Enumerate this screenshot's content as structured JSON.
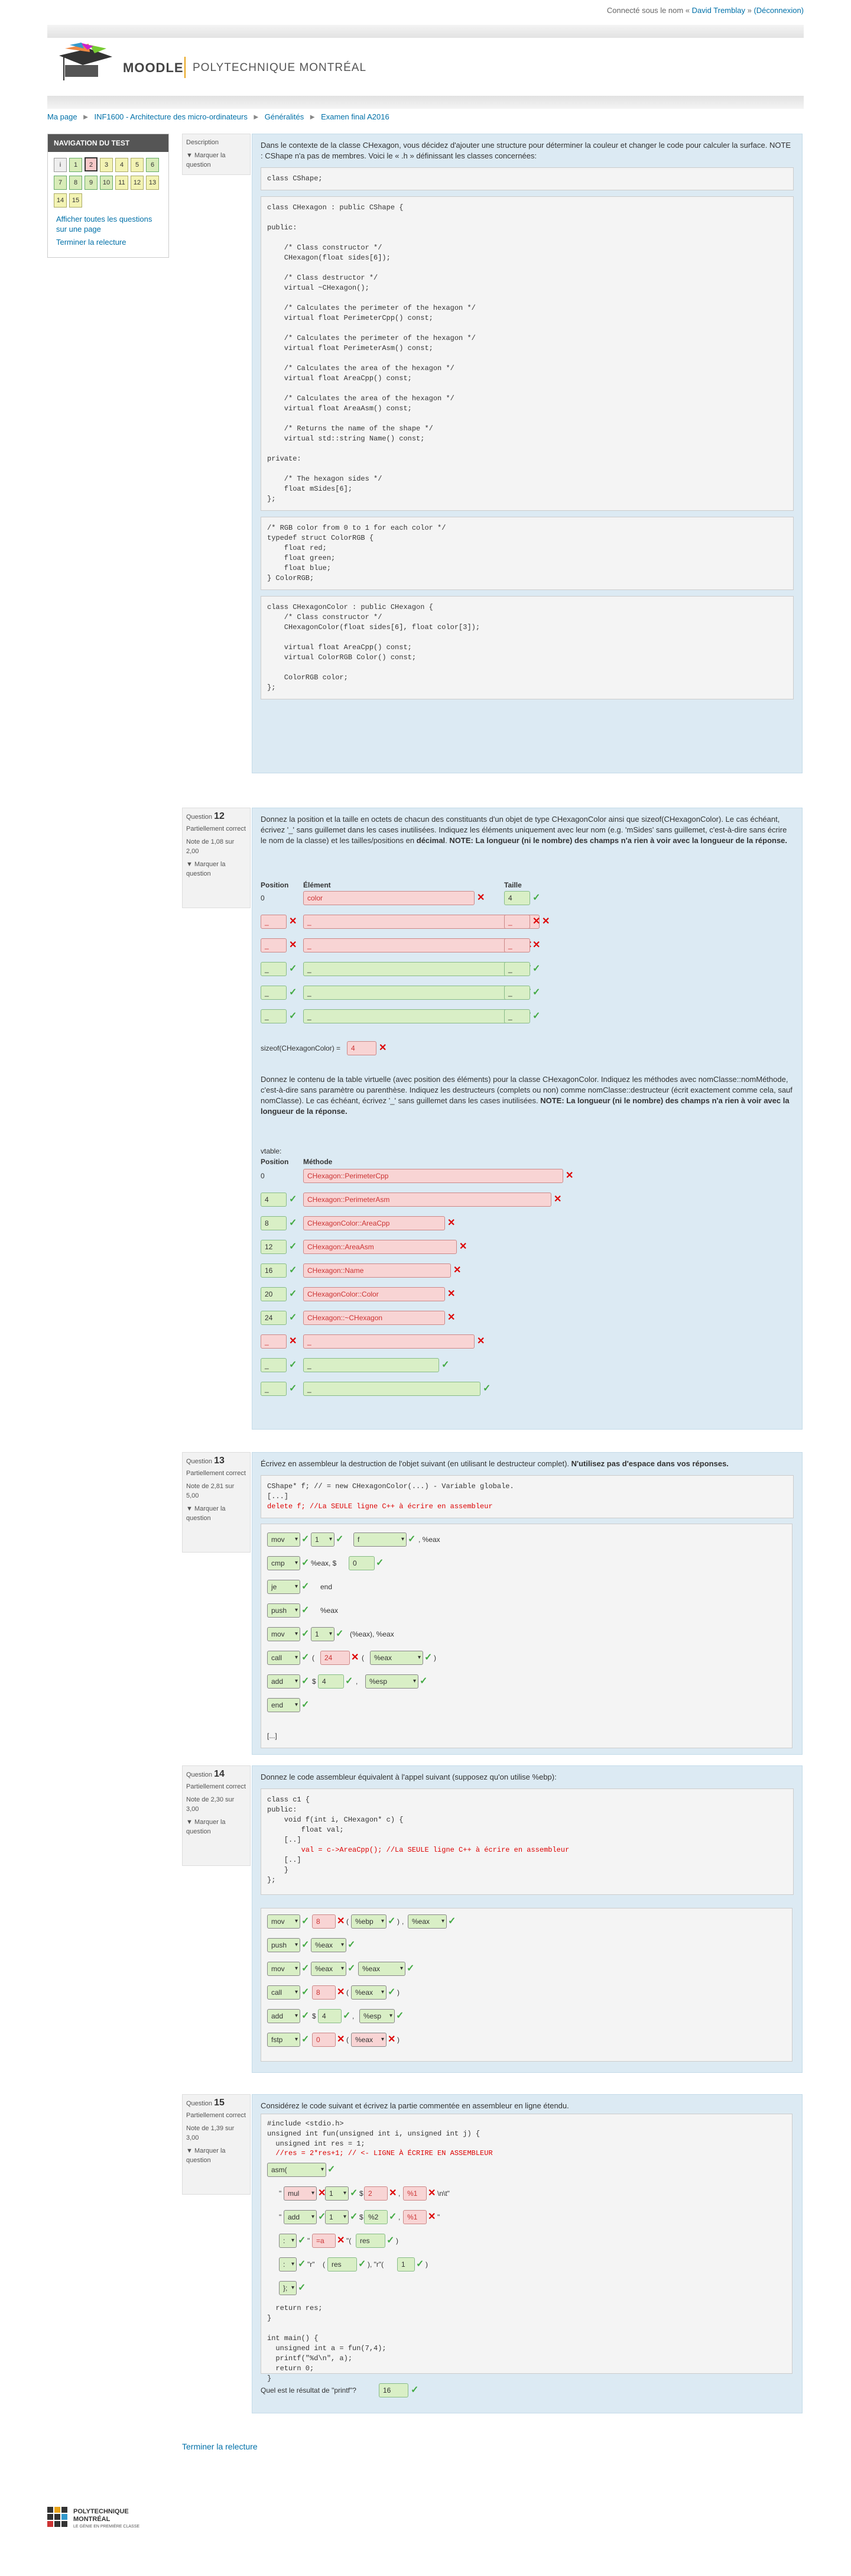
{
  "login": {
    "prefix": "Connecté sous le nom « ",
    "user": "David Tremblay",
    "suffix": " » ",
    "logout": "(Déconnexion)"
  },
  "header": {
    "moodle": "MOODLE",
    "school": "POLYTECHNIQUE MONTRÉAL"
  },
  "breadcrumb": [
    "Ma page",
    "INF1600 - Architecture des micro-ordinateurs",
    "Généralités",
    "Examen final A2016"
  ],
  "nav": {
    "title": "NAVIGATION DU TEST",
    "buttons": [
      {
        "n": "i",
        "s": "info"
      },
      {
        "n": "1",
        "s": "ok"
      },
      {
        "n": "2",
        "s": "bad"
      },
      {
        "n": "3",
        "s": "part"
      },
      {
        "n": "4",
        "s": "part"
      },
      {
        "n": "5",
        "s": "part"
      },
      {
        "n": "6",
        "s": "ok"
      },
      {
        "n": "7",
        "s": "ok"
      },
      {
        "n": "8",
        "s": "ok"
      },
      {
        "n": "9",
        "s": "ok"
      },
      {
        "n": "10",
        "s": "ok"
      },
      {
        "n": "11",
        "s": "part"
      },
      {
        "n": "12",
        "s": "part"
      },
      {
        "n": "13",
        "s": "part"
      },
      {
        "n": "14",
        "s": "part"
      },
      {
        "n": "15",
        "s": "part"
      }
    ],
    "show_all": "Afficher toutes les questions sur une page",
    "finish": "Terminer la relecture"
  },
  "desc": {
    "label": "Description",
    "flag": "Marquer la question",
    "intro": "Dans le contexte de la classe CHexagon, vous décidez d'ajouter une structure pour déterminer la couleur et changer le code pour calculer la surface.  NOTE : CShape n'a pas de membres. Voici le « .h » définissant les classes concernées:",
    "code1": "class CShape;",
    "code2": "class CHexagon : public CShape {\n\npublic:\n\n    /* Class constructor */\n    CHexagon(float sides[6]);\n\n    /* Class destructor */\n    virtual ~CHexagon();\n\n    /* Calculates the perimeter of the hexagon */\n    virtual float PerimeterCpp() const;\n\n    /* Calculates the perimeter of the hexagon */\n    virtual float PerimeterAsm() const;\n\n    /* Calculates the area of the hexagon */\n    virtual float AreaCpp() const;\n\n    /* Calculates the area of the hexagon */\n    virtual float AreaAsm() const;\n\n    /* Returns the name of the shape */\n    virtual std::string Name() const;\n\nprivate:\n\n    /* The hexagon sides */\n    float mSides[6];\n};",
    "code3": "/* RGB color from 0 to 1 for each color */\ntypedef struct ColorRGB {\n    float red;\n    float green;\n    float blue;\n} ColorRGB;",
    "code4": "class CHexagonColor : public CHexagon {\n    /* Class constructor */\n    CHexagonColor(float sides[6], float color[3]);\n\n    virtual float AreaCpp() const;\n    virtual ColorRGB Color() const;\n\n    ColorRGB color;\n};"
  },
  "q12": {
    "label": "Question",
    "num": "12",
    "state": "Partiellement correct",
    "grade": "Note de 1,08 sur 2,00",
    "flag": "Marquer la question",
    "text": "Donnez la position et la taille en octets de chacun des constituants d'un objet de type CHexagonColor ainsi que sizeof(CHexagonColor). Le cas échéant, écrivez '_' sans guillemet dans les cases inutilisées. Indiquez les éléments uniquement avec leur nom (e.g. 'mSides' sans guillemet, c'est-à-dire sans écrire le nom de la classe) et les tailles/positions en ",
    "text_b1": "décimal",
    "text2": ". ",
    "text_b2": "NOTE: La longueur (ni le nombre) des champs n'a rien à voir avec la longueur de la réponse.",
    "col_pos": "Position",
    "col_elem": "Élément",
    "col_size": "Taille",
    "rows": [
      {
        "pos": "0",
        "elem": "color",
        "size": "4"
      },
      {
        "pos": "_",
        "elem": "_",
        "size": "_"
      },
      {
        "pos": "_",
        "elem": "_",
        "size": "_"
      },
      {
        "pos": "_",
        "elem": "_",
        "size": "_"
      },
      {
        "pos": "_",
        "elem": "_",
        "size": "_"
      },
      {
        "pos": "_",
        "elem": "_",
        "size": "_"
      }
    ],
    "sizeof_label": "sizeof(CHexagonColor) =",
    "sizeof_val": "4",
    "text3": "Donnez le contenu de la table virtuelle (avec position des éléments) pour la classe CHexagonColor. Indiquez les méthodes avec nomClasse::nomMéthode, c'est-à-dire sans paramètre ou parenthèse. Indiquez les destructeurs (complets ou non) comme nomClasse::destructeur (écrit exactement comme cela, sauf nomClasse). Le cas échéant, écrivez '_' sans guillemet dans les cases inutilisées. ",
    "text3_b": "NOTE: La longueur (ni le nombre) des champs n'a rien à voir avec la longueur de la réponse.",
    "vtable": "vtable:",
    "col_meth": "Méthode",
    "vrows": [
      {
        "pos": "0",
        "m": "CHexagon::PerimeterCpp"
      },
      {
        "pos": "4",
        "m": "CHexagon::PerimeterAsm"
      },
      {
        "pos": "8",
        "m": "CHexagonColor::AreaCpp"
      },
      {
        "pos": "12",
        "m": "CHexagon::AreaAsm"
      },
      {
        "pos": "16",
        "m": "CHexagon::Name"
      },
      {
        "pos": "20",
        "m": "CHexagonColor::Color"
      },
      {
        "pos": "24",
        "m": "CHexagon::~CHexagon"
      },
      {
        "pos": "_",
        "m": "_"
      },
      {
        "pos": "_",
        "m": "_"
      },
      {
        "pos": "_",
        "m": "_"
      }
    ]
  },
  "q13": {
    "label": "Question",
    "num": "13",
    "state": "Partiellement correct",
    "grade": "Note de 2,81 sur 5,00",
    "flag": "Marquer la question",
    "text": "Écrivez en assembleur la destruction de l'objet suivant (en utilisant le destructeur complet). ",
    "text_b": "N'utilisez pas d'espace dans vos réponses.",
    "code_l1": "CShape* f; // = new CHexagonColor(...) - Variable globale.",
    "code_l2": "[...]",
    "code_l3": "delete f; //La SEULE ligne C++ à écrire en assembleur",
    "lines": [
      [
        "mov",
        "1",
        "f",
        ", %eax"
      ],
      [
        "cmp",
        "%eax, $",
        "0",
        ""
      ],
      [
        "je",
        "end"
      ],
      [
        "push",
        "%eax"
      ],
      [
        "mov",
        "1",
        "(%eax), %eax"
      ],
      [
        "call",
        "24",
        "%eax",
        ")"
      ],
      [
        "add",
        "$",
        "4",
        ", ",
        "%esp"
      ],
      [
        "end",
        ":"
      ]
    ],
    "ellipsis": "[...]"
  },
  "q14": {
    "label": "Question",
    "num": "14",
    "state": "Partiellement correct",
    "grade": "Note de 2,30 sur 3,00",
    "flag": "Marquer la question",
    "text": "Donnez le code assembleur équivalent à l'appel suivant (supposez qu'on utilise %ebp):",
    "code": "class c1 {\npublic:\n    void f(int i, CHexagon* c) {\n        float val;\n    [..]\n        val = c->AreaCpp(); //La SEULE ligne C++ à écrire en assembleur\n    [..]\n    }\n};",
    "red_line": "        val = c->AreaCpp(); //La SEULE ligne C++ à écrire en assembleur",
    "lines": [
      [
        "mov",
        "8",
        "(",
        "%ebp",
        ")",
        ",",
        "%eax"
      ],
      [
        "push",
        "%eax"
      ],
      [
        "mov",
        "%eax",
        "%eax"
      ],
      [
        "call",
        "8",
        "(",
        "%eax",
        ")"
      ],
      [
        "add",
        "$",
        "4",
        ",",
        "%esp"
      ],
      [
        "fstp",
        "0",
        "(",
        "%eax",
        ")"
      ]
    ]
  },
  "q15": {
    "label": "Question",
    "num": "15",
    "state": "Partiellement correct",
    "grade": "Note de 1,39 sur 3,00",
    "flag": "Marquer la question",
    "text": "Considérez le code suivant et écrivez la partie commentée en assembleur en ligne étendu.",
    "code_a": "#include <stdio.h>\nunsigned int fun(unsigned int i, unsigned int j) {\n  unsigned int res = 1;",
    "code_red": "  //res = 2*res+1; // <- LIGNE À ÉCRIRE EN ASSEMBLEUR",
    "asm": "asm(",
    "l_mul": [
      "mul",
      "1",
      "2",
      "%1"
    ],
    "l_mul_tail": "\\n\\t\"",
    "l_add": [
      "add",
      "1",
      "%2",
      "%1"
    ],
    "l_out": [
      ":",
      "=a",
      "res"
    ],
    "l_in": [
      ":",
      "\"r\"",
      "res",
      ", \"r\"",
      "1"
    ],
    "l_end": "};",
    "code_b": "  return res;\n}\n\nint main() {\n  unsigned int a = fun(7,4);\n  printf(\"%d\\n\", a);\n  return 0;\n}",
    "result_q": "Quel est le résultat de \"printf\"?",
    "result_val": "16"
  },
  "footer": {
    "finish": "Terminer la relecture",
    "logo1": "POLYTECHNIQUE",
    "logo2": "MONTRÉAL",
    "logo3": "LE GÉNIE EN PREMIÈRE CLASSE"
  }
}
